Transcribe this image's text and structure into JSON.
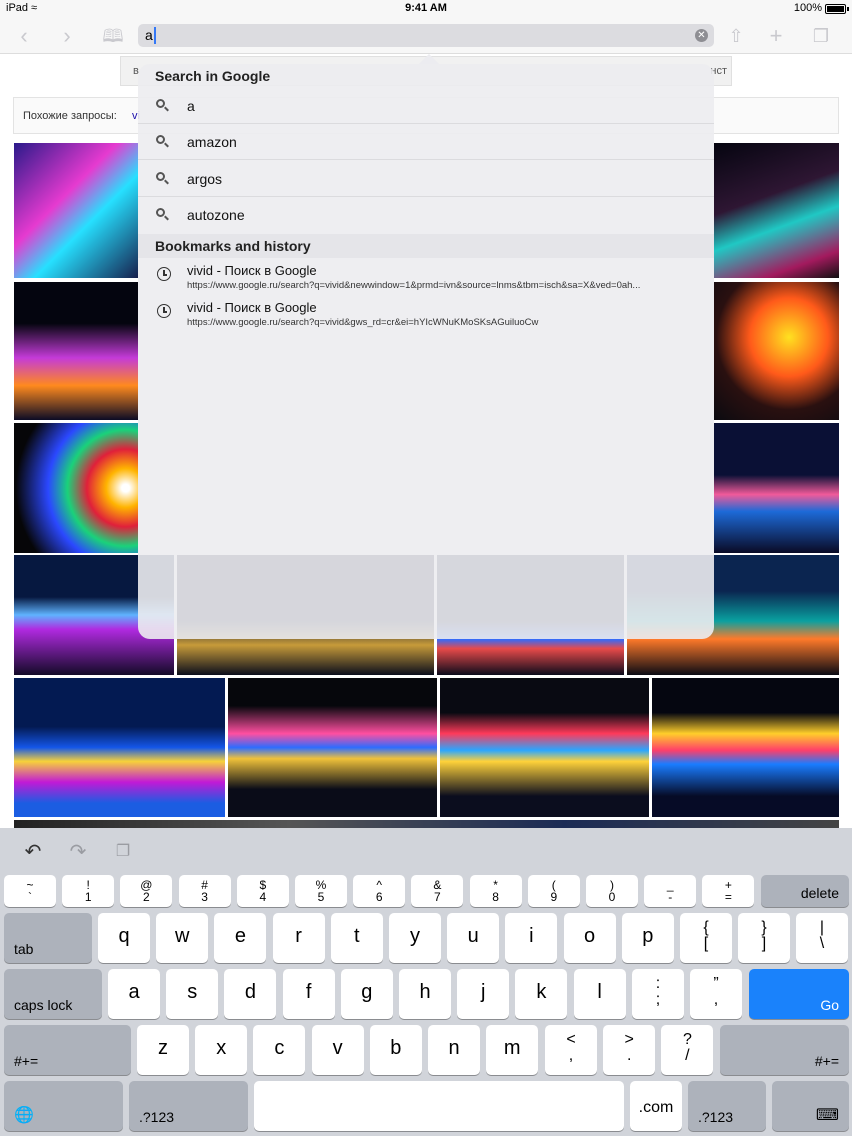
{
  "status": {
    "device": "iPad",
    "time": "9:41 AM",
    "battery": "100%"
  },
  "url_bar": {
    "text": "a"
  },
  "page": {
    "related_label": "Похожие запросы:",
    "related_link": "vi",
    "strip_left": "в",
    "strip_right": "нст"
  },
  "dropdown": {
    "search_header": "Search in Google",
    "suggestions": [
      "a",
      "amazon",
      "argos",
      "autozone"
    ],
    "history_header": "Bookmarks and history",
    "history": [
      {
        "title": "vivid - Поиск в Google",
        "url": "https://www.google.ru/search?q=vivid&newwindow=1&prmd=ivn&source=lnms&tbm=isch&sa=X&ved=0ah..."
      },
      {
        "title": "vivid - Поиск в Google",
        "url": "https://www.google.ru/search?q=vivid&gws_rd=cr&ei=hYIcWNuKMoSKsAGuiluoCw"
      }
    ]
  },
  "keyboard": {
    "num_row": [
      {
        "up": "~",
        "dn": "`"
      },
      {
        "up": "!",
        "dn": "1"
      },
      {
        "up": "@",
        "dn": "2"
      },
      {
        "up": "#",
        "dn": "3"
      },
      {
        "up": "$",
        "dn": "4"
      },
      {
        "up": "%",
        "dn": "5"
      },
      {
        "up": "^",
        "dn": "6"
      },
      {
        "up": "&",
        "dn": "7"
      },
      {
        "up": "*",
        "dn": "8"
      },
      {
        "up": "(",
        "dn": "9"
      },
      {
        "up": ")",
        "dn": "0"
      },
      {
        "up": "_",
        "dn": "-"
      },
      {
        "up": "+",
        "dn": "="
      }
    ],
    "delete": "delete",
    "tab": "tab",
    "row_q": [
      "q",
      "w",
      "e",
      "r",
      "t",
      "y",
      "u",
      "i",
      "o",
      "p"
    ],
    "row_q_extra": [
      {
        "up": "{",
        "dn": "["
      },
      {
        "up": "}",
        "dn": "]"
      },
      {
        "up": "|",
        "dn": "\\"
      }
    ],
    "caps": "caps lock",
    "row_a": [
      "a",
      "s",
      "d",
      "f",
      "g",
      "h",
      "j",
      "k",
      "l"
    ],
    "row_a_extra": [
      {
        "up": ":",
        "dn": ";"
      },
      {
        "up": "”",
        "dn": ","
      }
    ],
    "go": "Go",
    "sym_left": "#+=",
    "row_z": [
      "z",
      "x",
      "c",
      "v",
      "b",
      "n",
      "m"
    ],
    "row_z_extra": [
      {
        "up": "<",
        "dn": ","
      },
      {
        "up": ">",
        "dn": "."
      },
      {
        "up": "?",
        "dn": "/"
      }
    ],
    "sym_right": "#+=",
    "num_left": ".?123",
    "dotcom": ".com",
    "num_right": ".?123"
  },
  "colors": {
    "accent": "#1a82fb",
    "keyboard_bg": "#d1d4da"
  }
}
